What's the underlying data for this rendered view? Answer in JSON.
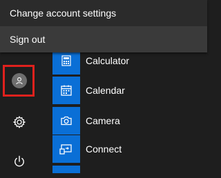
{
  "menu": {
    "items": [
      {
        "label": "Change account settings"
      },
      {
        "label": "Sign out"
      }
    ]
  },
  "rail": {
    "user_icon": "user-icon",
    "settings_icon": "gear-icon",
    "power_icon": "power-icon",
    "highlight_color": "#e0211d"
  },
  "apps": [
    {
      "label": "Calculator",
      "icon": "calculator-icon"
    },
    {
      "label": "Calendar",
      "icon": "calendar-icon"
    },
    {
      "label": "Camera",
      "icon": "camera-icon"
    },
    {
      "label": "Connect",
      "icon": "connect-icon"
    }
  ],
  "colors": {
    "tile": "#0a6fd6",
    "background": "#1e1e1e",
    "menu": "#2b2b2b"
  }
}
